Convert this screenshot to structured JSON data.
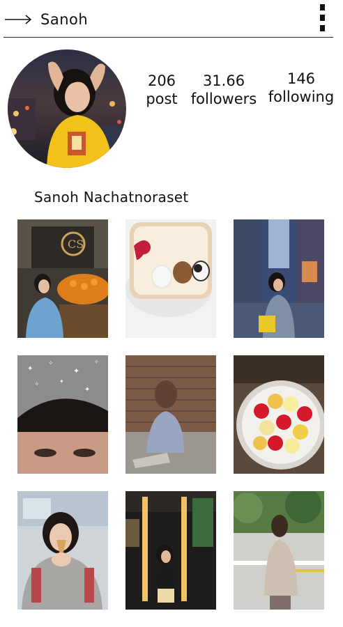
{
  "header": {
    "username": "Sanoh",
    "back_icon": "arrow-right-icon",
    "more_icon": "more-vertical-icon"
  },
  "profile": {
    "posts_count": "206",
    "posts_label": "post",
    "followers_count": "31.66",
    "followers_label": "followers",
    "following_count": "146",
    "following_label": "following",
    "full_name": "Sanoh Nachatnoraset"
  },
  "grid": {
    "photo_count": 9
  },
  "colors": {
    "text": "#111111",
    "background": "#ffffff",
    "divider": "#222222"
  }
}
